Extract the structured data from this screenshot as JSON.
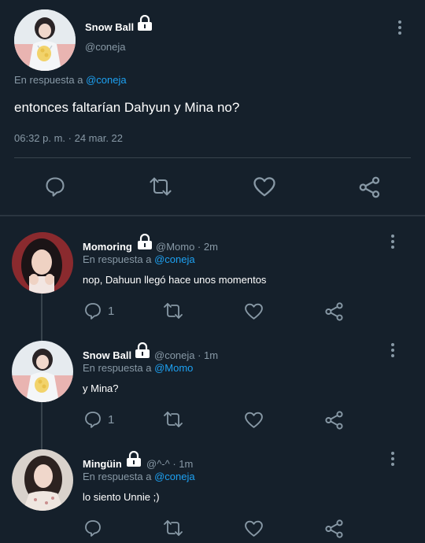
{
  "main_tweet": {
    "author_name": "Snow Ball",
    "author_handle": "@coneja",
    "reply_prefix": "En respuesta a",
    "reply_to": "@coneja",
    "text": "entonces faltarían Dahyun y Mina no?",
    "timestamp": "06:32 p. m. · 24 mar. 22"
  },
  "replies": [
    {
      "name": "Momoring",
      "meta": "@Momo · 2m",
      "reply_prefix": "En respuesta a",
      "reply_to": "@coneja",
      "text": "nop, Dahuun llegó hace unos momentos",
      "reply_count": "1"
    },
    {
      "name": "Snow Ball",
      "meta": "@coneja · 1m",
      "reply_prefix": "En respuesta a",
      "reply_to": "@Momo",
      "text": "y Mina?",
      "reply_count": "1"
    },
    {
      "name": "Mingüin",
      "meta": "@^-^ · 1m",
      "reply_prefix": "En respuesta a",
      "reply_to": "@coneja",
      "text": "lo siento Unnie ;)",
      "reply_count": ""
    }
  ],
  "colors": {
    "background": "#15202b",
    "link": "#1da1f2",
    "muted": "#8899a6",
    "divider": "#38444d"
  },
  "icons": [
    "lock-icon",
    "more-icon",
    "reply-icon",
    "retweet-icon",
    "like-icon",
    "share-icon"
  ]
}
